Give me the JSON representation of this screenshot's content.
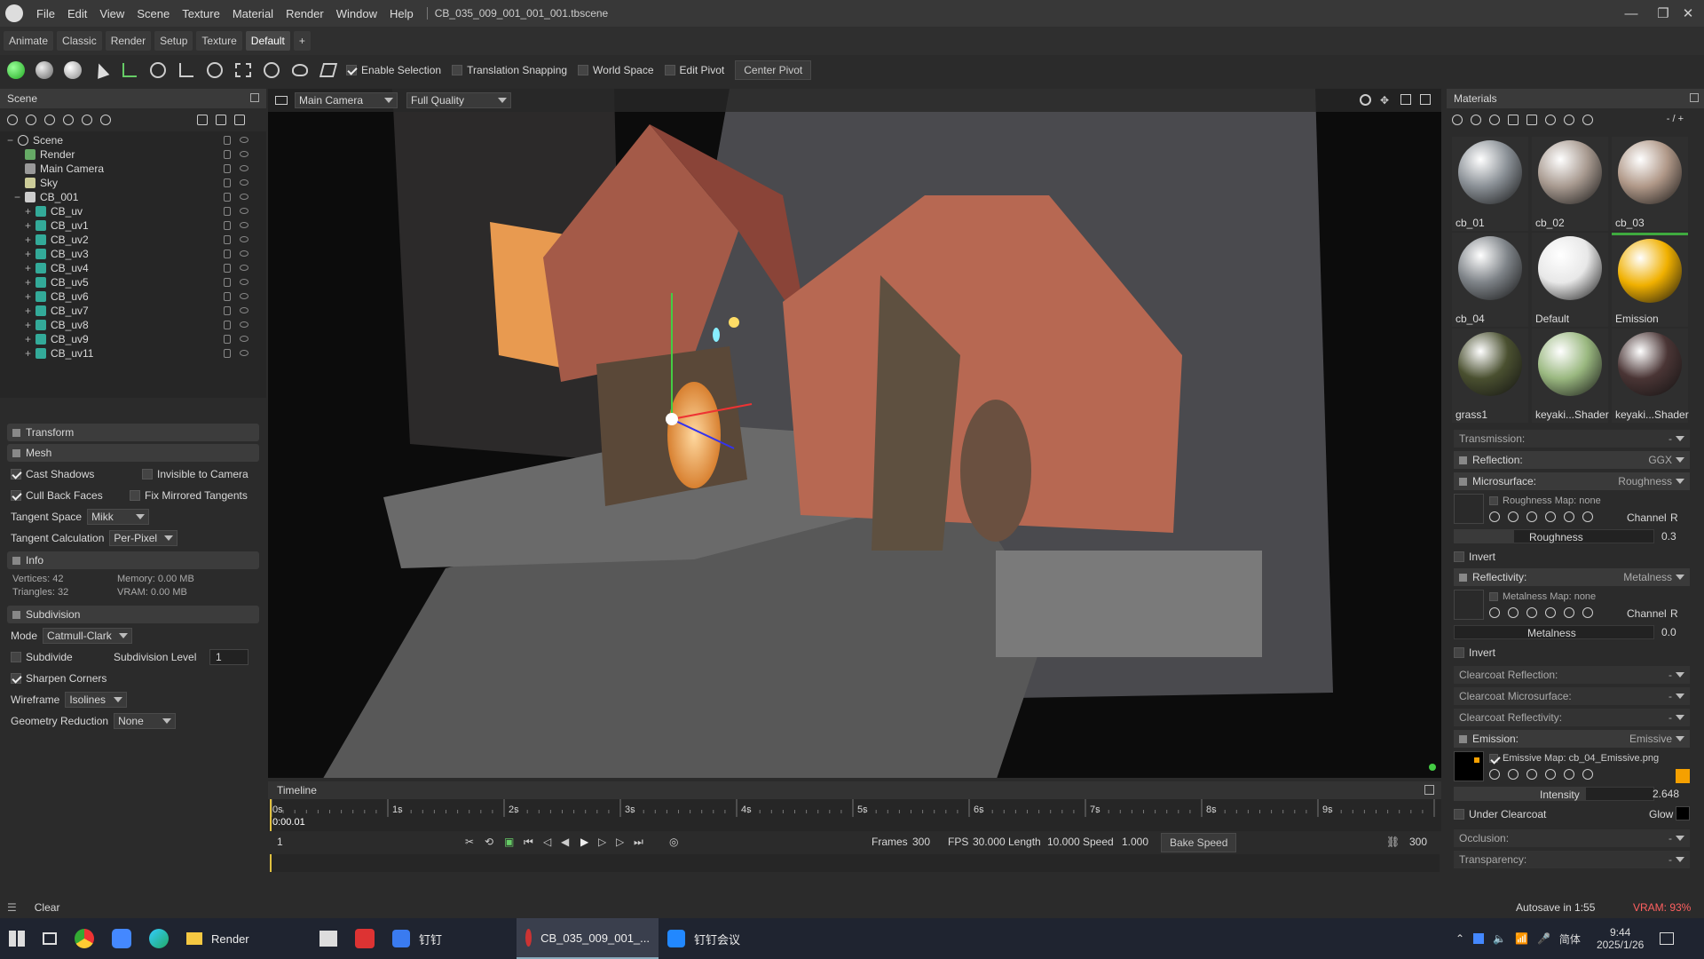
{
  "title_bar": {
    "menus": [
      "File",
      "Edit",
      "View",
      "Scene",
      "Texture",
      "Material",
      "Render",
      "Window",
      "Help"
    ],
    "window_title": "CB_035_009_001_001_001.tbscene"
  },
  "workspace_tabs": [
    "Animate",
    "Classic",
    "Render",
    "Setup",
    "Texture",
    "Default",
    "+"
  ],
  "toolbar": {
    "enable_selection": "Enable Selection",
    "translation_snapping": "Translation Snapping",
    "world_space": "World Space",
    "edit_pivot": "Edit Pivot",
    "center_pivot": "Center Pivot"
  },
  "scene_panel": {
    "title": "Scene",
    "items": [
      "Scene",
      "Render",
      "Main Camera",
      "Sky",
      "CB_001",
      "CB_uv",
      "CB_uv1",
      "CB_uv2",
      "CB_uv3",
      "CB_uv4",
      "CB_uv5",
      "CB_uv6",
      "CB_uv7",
      "CB_uv8",
      "CB_uv9",
      "CB_uv11"
    ]
  },
  "properties": {
    "transform": "Transform",
    "mesh": "Mesh",
    "cast_shadows": "Cast Shadows",
    "invisible_to_camera": "Invisible to Camera",
    "cull_back_faces": "Cull Back Faces",
    "fix_mirrored_tangents": "Fix Mirrored Tangents",
    "tangent_space_label": "Tangent Space",
    "tangent_space_value": "Mikk",
    "tangent_calc_label": "Tangent Calculation",
    "tangent_calc_value": "Per-Pixel",
    "info": "Info",
    "vertices": "Vertices: 42",
    "triangles": "Triangles: 32",
    "memory": "Memory: 0.00 MB",
    "vram": "VRAM: 0.00 MB",
    "subdivision": "Subdivision",
    "mode_label": "Mode",
    "mode_value": "Catmull-Clark",
    "subdivide": "Subdivide",
    "subdivision_level_label": "Subdivision Level",
    "subdivision_level_value": "1",
    "sharpen_corners": "Sharpen Corners",
    "wireframe_label": "Wireframe",
    "wireframe_value": "Isolines",
    "geometry_reduction_label": "Geometry Reduction",
    "geometry_reduction_value": "None"
  },
  "viewport": {
    "camera": "Main Camera",
    "quality": "Full Quality"
  },
  "timeline": {
    "title": "Timeline",
    "ticks": [
      "0s",
      "1s",
      "2s",
      "3s",
      "4s",
      "5s",
      "6s",
      "7s",
      "8s",
      "9s"
    ],
    "current_time": "0:00.01",
    "frame": "1",
    "frames_label": "Frames",
    "frames_value": "300",
    "fps_label": "FPS",
    "fps_value": "30.000",
    "length_label": "Length",
    "length_value": "10.000",
    "speed_label": "Speed",
    "speed_value": "1.000",
    "bake_speed": "Bake Speed",
    "end_frame": "300"
  },
  "materials": {
    "title": "Materials",
    "counter": "- / +",
    "items": [
      {
        "name": "cb_01",
        "color": "#8a9096"
      },
      {
        "name": "cb_02",
        "color": "#a89a90"
      },
      {
        "name": "cb_03",
        "color": "#b09888"
      },
      {
        "name": "cb_04",
        "color": "#7e8388"
      },
      {
        "name": "Default",
        "color": "#e8e8e8"
      },
      {
        "name": "Emission",
        "color": "#f0b000"
      },
      {
        "name": "grass1",
        "color": "#4a5030"
      },
      {
        "name": "keyaki...Shader",
        "color": "#9ab880"
      },
      {
        "name": "keyaki...Shader",
        "color": "#4a3535"
      }
    ],
    "transmission": "Transmission:",
    "transmission_value": "-",
    "reflection": "Reflection:",
    "reflection_value": "GGX",
    "microsurface": "Microsurface:",
    "microsurface_value": "Roughness",
    "roughness_map": "Roughness Map: none",
    "channel": "Channel",
    "channel_value": "R",
    "roughness_label": "Roughness",
    "roughness_value": "0.3",
    "invert": "Invert",
    "reflectivity": "Reflectivity:",
    "reflectivity_value": "Metalness",
    "metalness_map": "Metalness Map: none",
    "metalness_label": "Metalness",
    "metalness_value": "0.0",
    "clearcoat_reflection": "Clearcoat Reflection:",
    "clearcoat_microsurface": "Clearcoat Microsurface:",
    "clearcoat_reflectivity": "Clearcoat Reflectivity:",
    "emission": "Emission:",
    "emission_value": "Emissive",
    "emissive_map": "Emissive Map: cb_04_Emissive.png",
    "intensity_label": "Intensity",
    "intensity_value": "2.648",
    "under_clearcoat": "Under Clearcoat",
    "glow": "Glow",
    "occlusion": "Occlusion:",
    "transparency": "Transparency:",
    "dash": "-",
    "roughness_fraction": 0.3,
    "intensity_fraction": 0.66
  },
  "status": {
    "clear": "Clear",
    "autosave": "Autosave in 1:55",
    "vram": "VRAM: 93%"
  },
  "taskbar": {
    "render": "Render",
    "dingtalk": "钉钉",
    "app": "CB_035_009_001_...",
    "meeting": "钉钉会议",
    "ime": "简体",
    "time": "9:44",
    "date": "2025/1/26"
  },
  "colors": {
    "accent_green": "#3faa3f",
    "emission_orange": "#f5a000",
    "vram_red": "#ff6060"
  }
}
